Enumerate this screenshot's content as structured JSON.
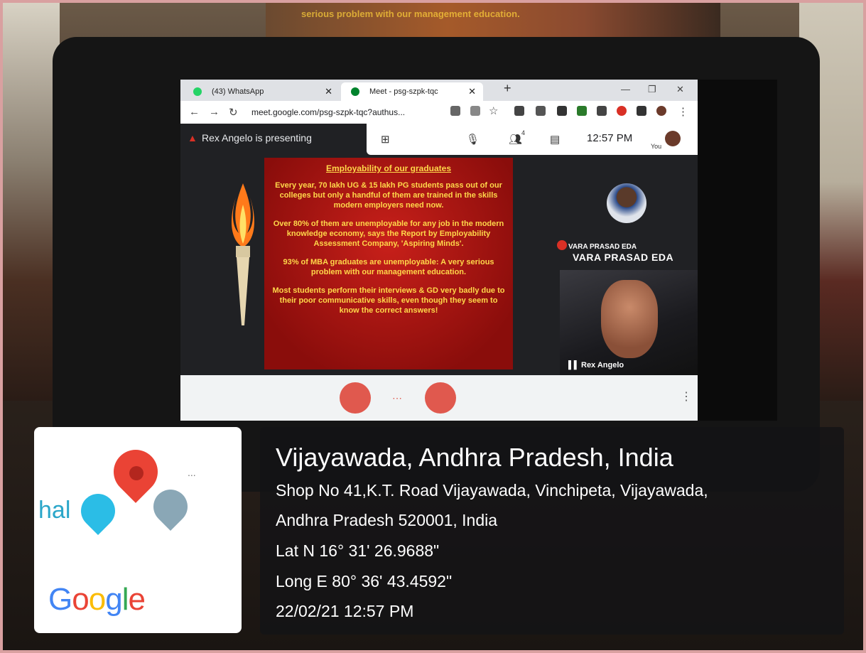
{
  "browser": {
    "tabs": [
      {
        "label": "(43) WhatsApp",
        "icon": "whatsapp-icon"
      },
      {
        "label": "Meet - psg-szpk-tqc",
        "icon": "meet-icon"
      }
    ],
    "url": "meet.google.com/psg-szpk-tqc?authus..."
  },
  "meet": {
    "presenting_text": "Rex Angelo is presenting",
    "time": "12:57 PM",
    "you_label": "You",
    "participant_count": "4",
    "tile1_name_small": "VARA PRASAD EDA",
    "tile1_name_large": "VARA PRASAD EDA",
    "tile2_name": "Rex Angelo"
  },
  "slide": {
    "title": "Employability of our graduates",
    "paragraphs": [
      "Every year, 70 lakh UG & 15 lakh PG students pass out of our colleges but only a handful of them are trained in the skills modern employers need now.",
      "Over 80% of them are unemployable for any job in the modern knowledge economy, says the Report by Employability Assessment Company, 'Aspiring Minds'.",
      "93% of MBA graduates are unemployable: A very serious problem with our management education.",
      "Most students perform their interviews & GD very badly due to their poor communicative skills, even though they seem to know the correct answers!"
    ]
  },
  "location": {
    "city": "Vijayawada, Andhra Pradesh, India",
    "address_line1": "Shop No 41,K.T. Road Vijayawada, Vinchipeta, Vijayawada,",
    "address_line2": "Andhra Pradesh 520001, India",
    "lat": "Lat N 16° 31' 26.9688\"",
    "long": "Long E 80° 36' 43.4592\"",
    "datetime": "22/02/21 12:57 PM"
  },
  "map_card": {
    "partial_text": "hal",
    "more": "...",
    "brand": [
      "G",
      "o",
      "o",
      "g",
      "l",
      "e"
    ]
  },
  "projector_text": "serious problem with our management education.",
  "colors": {
    "slide_bg": "#c8201a",
    "slide_text": "#ffd84a",
    "meet_dark": "#202124",
    "pin_red": "#ea4335"
  }
}
